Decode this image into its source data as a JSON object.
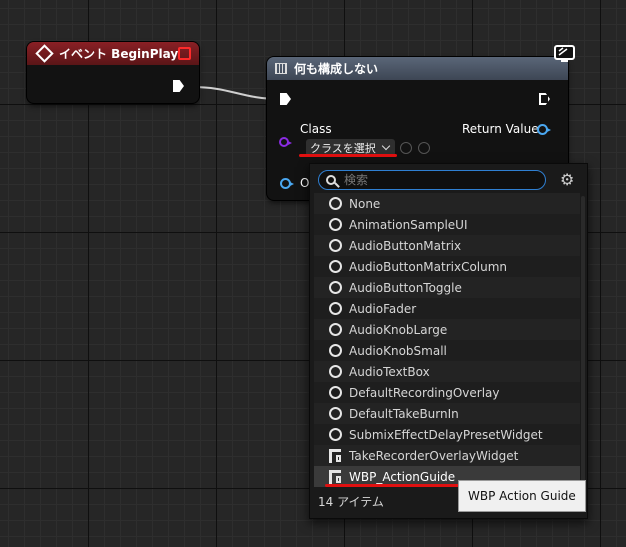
{
  "event_node": {
    "title": "イベント BeginPlay"
  },
  "create_node": {
    "title": "何も構成しない",
    "class_label": "Class",
    "return_label": "Return Value",
    "class_combo_value": "クラスを選択",
    "owner_label_partial": "O"
  },
  "picker": {
    "search_placeholder": "検索",
    "items": [
      {
        "label": "None",
        "icon": "none-icon"
      },
      {
        "label": "AnimationSampleUI",
        "icon": "none-icon"
      },
      {
        "label": "AudioButtonMatrix",
        "icon": "none-icon"
      },
      {
        "label": "AudioButtonMatrixColumn",
        "icon": "none-icon"
      },
      {
        "label": "AudioButtonToggle",
        "icon": "none-icon"
      },
      {
        "label": "AudioFader",
        "icon": "none-icon"
      },
      {
        "label": "AudioKnobLarge",
        "icon": "none-icon"
      },
      {
        "label": "AudioKnobSmall",
        "icon": "none-icon"
      },
      {
        "label": "AudioTextBox",
        "icon": "none-icon"
      },
      {
        "label": "DefaultRecordingOverlay",
        "icon": "none-icon"
      },
      {
        "label": "DefaultTakeBurnIn",
        "icon": "none-icon"
      },
      {
        "label": "SubmixEffectDelayPresetWidget",
        "icon": "none-icon"
      },
      {
        "label": "TakeRecorderOverlayWidget",
        "icon": "widget-blueprint-icon"
      },
      {
        "label": "WBP_ActionGuide",
        "icon": "widget-blueprint-icon"
      }
    ],
    "item_count": "14 アイテム"
  },
  "tooltip": {
    "text": "WBP Action Guide"
  },
  "colors": {
    "event_header": "#8a2025",
    "call_header": "#4b5566",
    "highlight_underline": "#e01010",
    "class_pin": "#8a2be2",
    "object_pin": "#4aa7f0"
  }
}
